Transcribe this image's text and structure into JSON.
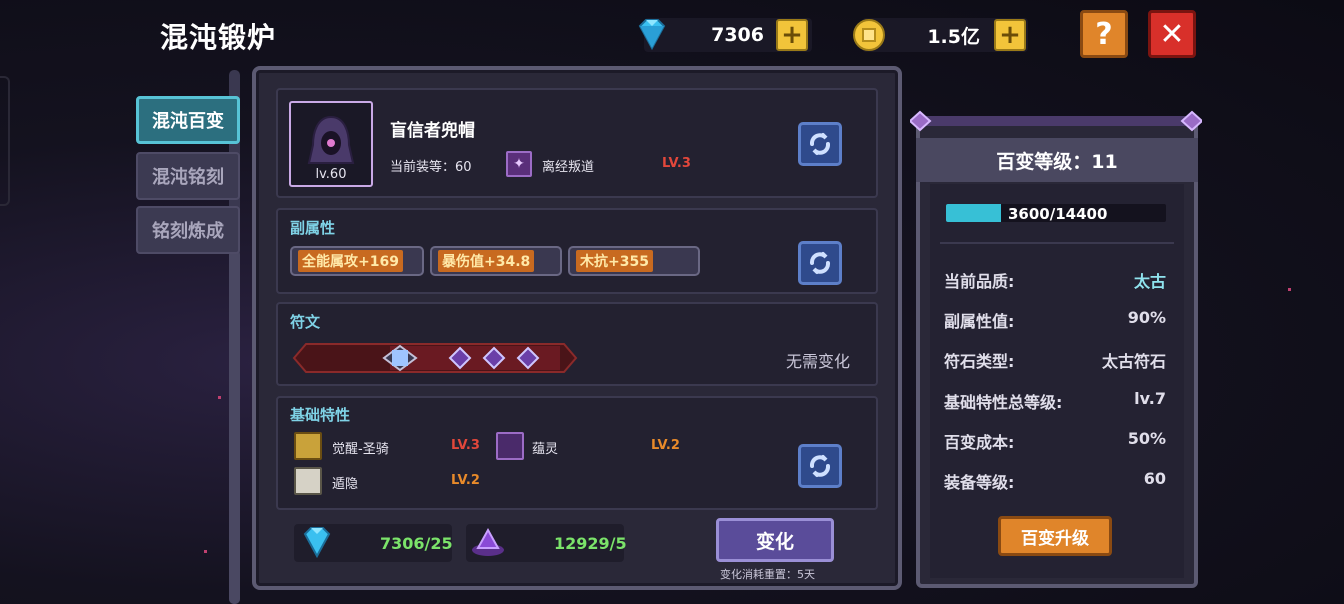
{
  "title": "混沌锻炉",
  "currency": {
    "diamonds": "7306",
    "gold": "1.5亿"
  },
  "tabs": [
    "混沌百变",
    "混沌铭刻",
    "铭刻炼成"
  ],
  "item": {
    "name": "盲信者兜帽",
    "level_badge": "lv.60",
    "equip_level_label": "当前装等：",
    "equip_level": "60",
    "skill_name": "离经叛道",
    "skill_level": "LV.3"
  },
  "sub_attr": {
    "title": "副属性",
    "pills": [
      "全能属攻+169",
      "暴伤值+34.8",
      "木抗+355"
    ]
  },
  "rune": {
    "title": "符文",
    "status": "无需变化"
  },
  "base_traits": {
    "title": "基础特性",
    "traits": [
      {
        "name": "觉醒-圣骑",
        "level": "LV.3"
      },
      {
        "name": "蕴灵",
        "level": "LV.2"
      },
      {
        "name": "遁隐",
        "level": "LV.2"
      }
    ]
  },
  "costs": {
    "diamond": "7306/25",
    "essence": "12929/5"
  },
  "transform": {
    "label": "变化",
    "note": "变化消耗重置：5天"
  },
  "side": {
    "title": "百变等级：11",
    "progress_text": "3600/14400",
    "progress_fraction": 0.25,
    "stats": [
      {
        "label": "当前品质:",
        "value": "太古",
        "color": "#8fe3ee"
      },
      {
        "label": "副属性值:",
        "value": "90%"
      },
      {
        "label": "符石类型:",
        "value": "太古符石"
      },
      {
        "label": "基础特性总等级:",
        "value": "lv.7"
      },
      {
        "label": "百变成本:",
        "value": "50%"
      },
      {
        "label": "装备等级:",
        "value": "60"
      }
    ],
    "upgrade_label": "百变升级"
  },
  "colors": {
    "accent": "#57c3d6",
    "gold": "#f2c43a",
    "close": "#d8302a",
    "help": "#e0852a"
  }
}
